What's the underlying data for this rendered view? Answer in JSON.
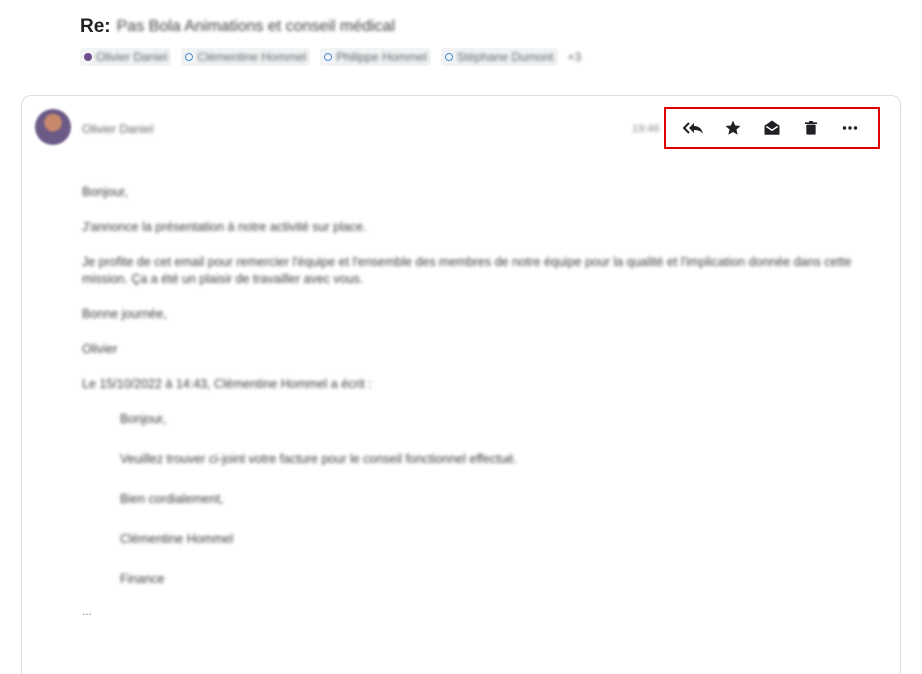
{
  "subject": {
    "prefix": "Re:",
    "text": "Pas Bola Animations et conseil médical"
  },
  "recipients": [
    {
      "name": "Olivier Daniel",
      "style": "filled"
    },
    {
      "name": "Clémentine Hommel",
      "style": "outline"
    },
    {
      "name": "Philippe Hommel",
      "style": "outline"
    },
    {
      "name": "Stéphane Dumont",
      "style": "outline"
    }
  ],
  "recipients_more": "+3",
  "message": {
    "sender_name": "Olivier Daniel",
    "date_short": "19:46",
    "toolbar": {
      "reply_all": "reply-all",
      "star": "star",
      "mark_read": "mark-as-read",
      "delete": "delete",
      "more": "more"
    },
    "body": [
      "Bonjour,",
      "J'annonce la présentation à notre activité sur place.",
      "Je profite de cet email pour remercier l'équipe et l'ensemble des membres de notre équipe pour la qualité et l'implication donnée dans cette mission. Ça a été un plaisir de travailler avec vous.",
      "Bonne journée,",
      "Olivier"
    ],
    "quote_header": "Le 15/10/2022 à 14:43, Clémentine Hommel a écrit :",
    "quote_body": [
      "Bonjour,",
      "Veuillez trouver ci-joint votre facture pour le conseil fonctionnel effectué.",
      "Bien cordialement,",
      "Clémentine Hommel",
      "Finance"
    ],
    "trailing": "..."
  }
}
